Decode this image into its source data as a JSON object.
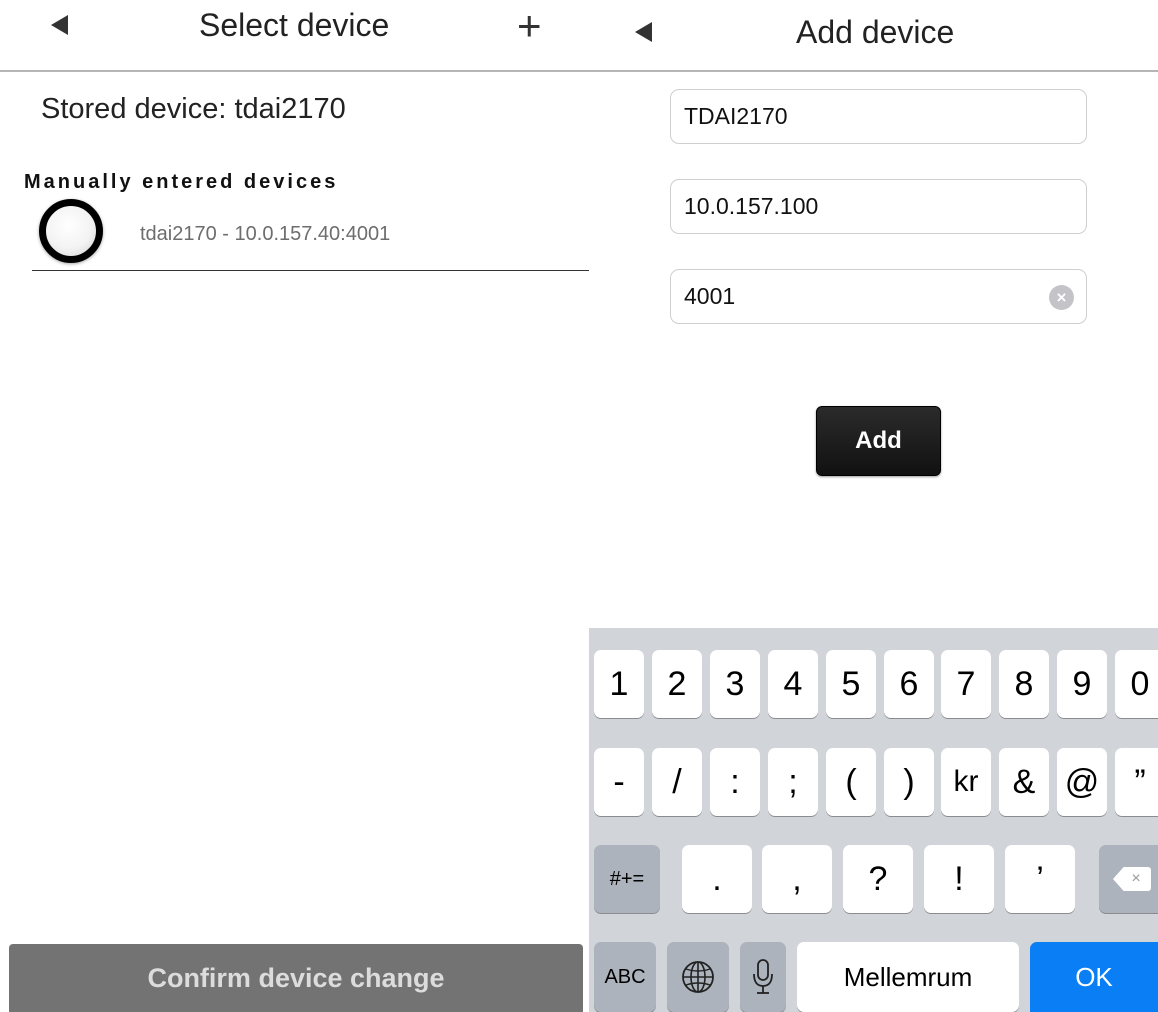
{
  "left": {
    "title": "Select device",
    "add_symbol": "+",
    "stored_device": "Stored device: tdai2170",
    "section_heading": "Manually entered devices",
    "devices": [
      {
        "label": "tdai2170 - 10.0.157.40:4001"
      }
    ],
    "confirm_label": "Confirm device change"
  },
  "right": {
    "title": "Add device",
    "fields": {
      "name": "TDAI2170",
      "ip": "10.0.157.100",
      "port": "4001"
    },
    "add_label": "Add",
    "clear_symbol": "×"
  },
  "keyboard": {
    "row1": [
      "1",
      "2",
      "3",
      "4",
      "5",
      "6",
      "7",
      "8",
      "9",
      "0"
    ],
    "row2": [
      "-",
      "/",
      ":",
      ";",
      "(",
      ")",
      "kr",
      "&",
      "@",
      "”"
    ],
    "row3": {
      "shift": "#+=",
      "keys": [
        ".",
        ",",
        "?",
        "!",
        "’"
      ],
      "delete_symbol": "×"
    },
    "row4": {
      "abc": "ABC",
      "space": "Mellemrum",
      "ok": "OK"
    }
  },
  "colors": {
    "ok_key": "#0a7ff5",
    "keyboard_bg": "#d1d4d9",
    "confirm_bg": "#737373",
    "add_button_bg": "#1c1c1c"
  }
}
